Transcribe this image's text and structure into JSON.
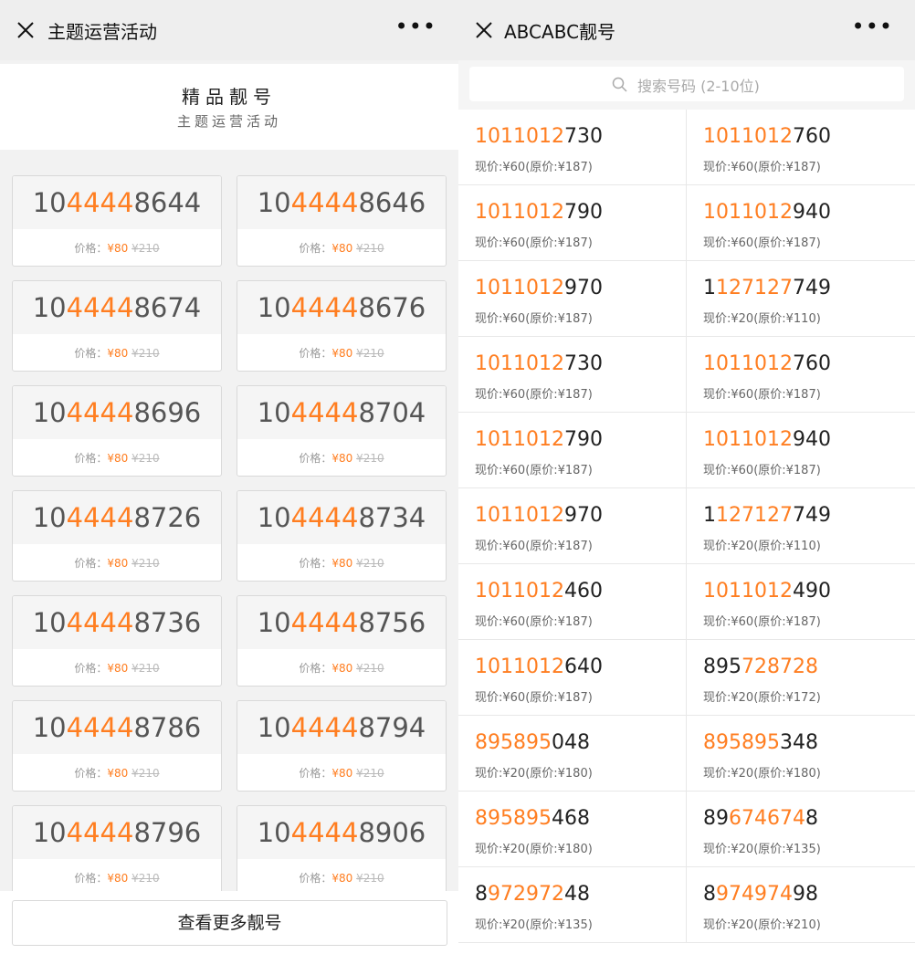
{
  "left": {
    "title": "主题运营活动",
    "more": "•••",
    "banner_title": "精品靓号",
    "banner_subtitle": "主题运营活动",
    "price_label": "价格：",
    "cards": [
      {
        "pre": "10",
        "hl": "4444",
        "post": "8644",
        "now": "¥80",
        "orig": "¥210"
      },
      {
        "pre": "10",
        "hl": "4444",
        "post": "8646",
        "now": "¥80",
        "orig": "¥210"
      },
      {
        "pre": "10",
        "hl": "4444",
        "post": "8674",
        "now": "¥80",
        "orig": "¥210"
      },
      {
        "pre": "10",
        "hl": "4444",
        "post": "8676",
        "now": "¥80",
        "orig": "¥210"
      },
      {
        "pre": "10",
        "hl": "4444",
        "post": "8696",
        "now": "¥80",
        "orig": "¥210"
      },
      {
        "pre": "10",
        "hl": "4444",
        "post": "8704",
        "now": "¥80",
        "orig": "¥210"
      },
      {
        "pre": "10",
        "hl": "4444",
        "post": "8726",
        "now": "¥80",
        "orig": "¥210"
      },
      {
        "pre": "10",
        "hl": "4444",
        "post": "8734",
        "now": "¥80",
        "orig": "¥210"
      },
      {
        "pre": "10",
        "hl": "4444",
        "post": "8736",
        "now": "¥80",
        "orig": "¥210"
      },
      {
        "pre": "10",
        "hl": "4444",
        "post": "8756",
        "now": "¥80",
        "orig": "¥210"
      },
      {
        "pre": "10",
        "hl": "4444",
        "post": "8786",
        "now": "¥80",
        "orig": "¥210"
      },
      {
        "pre": "10",
        "hl": "4444",
        "post": "8794",
        "now": "¥80",
        "orig": "¥210"
      },
      {
        "pre": "10",
        "hl": "4444",
        "post": "8796",
        "now": "¥80",
        "orig": "¥210"
      },
      {
        "pre": "10",
        "hl": "4444",
        "post": "8906",
        "now": "¥80",
        "orig": "¥210"
      }
    ],
    "more_button": "查看更多靓号"
  },
  "right": {
    "title": "ABCABC靓号",
    "more": "•••",
    "search_placeholder": "搜索号码 (2-10位)",
    "items": [
      {
        "pre": "",
        "hl": "1011012",
        "post": "",
        "tail": "730",
        "price": "现价:¥60(原价:¥187)"
      },
      {
        "pre": "",
        "hl": "1011012",
        "post": "",
        "tail": "760",
        "price": "现价:¥60(原价:¥187)"
      },
      {
        "pre": "",
        "hl": "1011012",
        "post": "",
        "tail": "790",
        "price": "现价:¥60(原价:¥187)"
      },
      {
        "pre": "",
        "hl": "1011012",
        "post": "",
        "tail": "940",
        "price": "现价:¥60(原价:¥187)"
      },
      {
        "pre": "",
        "hl": "1011012",
        "post": "",
        "tail": "970",
        "price": "现价:¥60(原价:¥187)"
      },
      {
        "pre": "1",
        "hl": "127127",
        "post": "",
        "tail": "749",
        "price": "现价:¥20(原价:¥110)"
      },
      {
        "pre": "",
        "hl": "1011012",
        "post": "",
        "tail": "730",
        "price": "现价:¥60(原价:¥187)"
      },
      {
        "pre": "",
        "hl": "1011012",
        "post": "",
        "tail": "760",
        "price": "现价:¥60(原价:¥187)"
      },
      {
        "pre": "",
        "hl": "1011012",
        "post": "",
        "tail": "790",
        "price": "现价:¥60(原价:¥187)"
      },
      {
        "pre": "",
        "hl": "1011012",
        "post": "",
        "tail": "940",
        "price": "现价:¥60(原价:¥187)"
      },
      {
        "pre": "",
        "hl": "1011012",
        "post": "",
        "tail": "970",
        "price": "现价:¥60(原价:¥187)"
      },
      {
        "pre": "1",
        "hl": "127127",
        "post": "",
        "tail": "749",
        "price": "现价:¥20(原价:¥110)"
      },
      {
        "pre": "",
        "hl": "1011012",
        "post": "",
        "tail": "460",
        "price": "现价:¥60(原价:¥187)"
      },
      {
        "pre": "",
        "hl": "1011012",
        "post": "",
        "tail": "490",
        "price": "现价:¥60(原价:¥187)"
      },
      {
        "pre": "",
        "hl": "1011012",
        "post": "",
        "tail": "640",
        "price": "现价:¥60(原价:¥187)"
      },
      {
        "pre": "895",
        "hl": "728728",
        "post": "",
        "tail": "",
        "price": "现价:¥20(原价:¥172)"
      },
      {
        "pre": "",
        "hl": "895895",
        "post": "",
        "tail": "048",
        "price": "现价:¥20(原价:¥180)"
      },
      {
        "pre": "",
        "hl": "895895",
        "post": "",
        "tail": "348",
        "price": "现价:¥20(原价:¥180)"
      },
      {
        "pre": "",
        "hl": "895895",
        "post": "",
        "tail": "468",
        "price": "现价:¥20(原价:¥180)"
      },
      {
        "pre": "89",
        "hl": "674674",
        "post": "",
        "tail": "8",
        "price": "现价:¥20(原价:¥135)"
      },
      {
        "pre": "8",
        "hl": "972972",
        "post": "",
        "tail": "48",
        "price": "现价:¥20(原价:¥135)"
      },
      {
        "pre": "8",
        "hl": "974974",
        "post": "",
        "tail": "98",
        "price": "现价:¥20(原价:¥210)"
      }
    ]
  },
  "colors": {
    "accent": "#ff7e21",
    "title_bar": "#eeeeee",
    "panel_bg": "#f2f2f2"
  }
}
